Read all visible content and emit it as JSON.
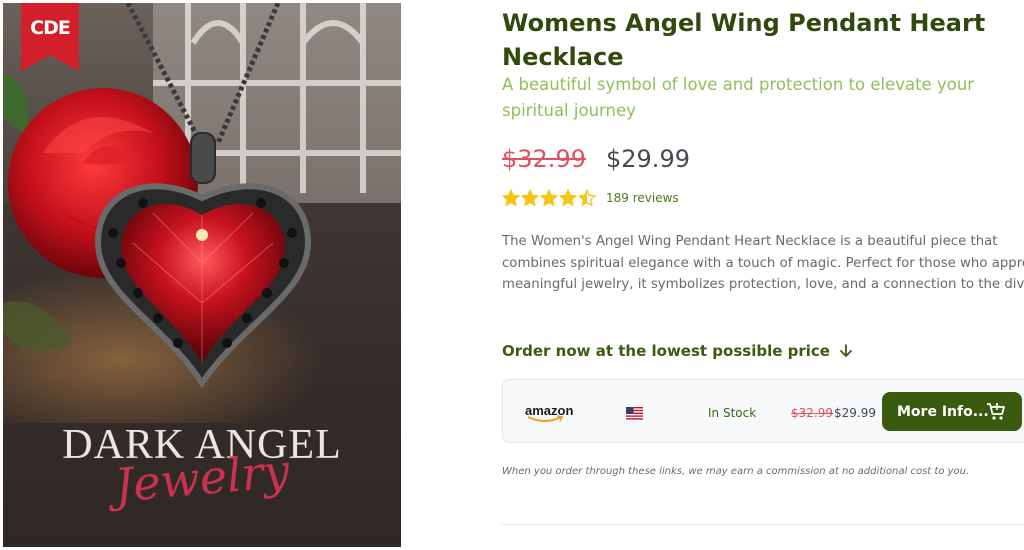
{
  "product": {
    "brand_logo_text": "CDE",
    "image_title": "DARK ANGEL",
    "image_subtitle": "Jewelry",
    "title": "Womens Angel Wing Pendant Heart Necklace",
    "subtitle": "A beautiful symbol of love and protection to elevate your spiritual journey",
    "price_old": "$32.99",
    "price_new": "$29.99",
    "rating": 4.5,
    "rating_max": 5,
    "reviews_text": "189 reviews",
    "description_lines": [
      "The Women's Angel Wing Pendant Heart Necklace is a beautiful piece that",
      "combines spiritual elegance with a touch of magic. Perfect for those who apprecia",
      "meaningful jewelry, it symbolizes protection, love, and a connection to the divine."
    ]
  },
  "order": {
    "heading": "Order now at the lowest possible price",
    "heading_icon": "arrow-down-icon",
    "offers": [
      {
        "retailer": "amazon",
        "country_flag": "us-flag-icon",
        "stock": "In Stock",
        "price_old": "$32.99",
        "price_new": "$29.99",
        "button_label": "More Info...",
        "button_icon": "cart-icon"
      }
    ],
    "disclaimer": "When you order through these links, we may earn a commission at no additional cost to you."
  },
  "colors": {
    "title": "#2f4a0c",
    "subtitle": "#8fbf5a",
    "price_old": "#e05060",
    "star": "#f5c518",
    "button_bg": "#3a5a0f",
    "brand_ribbon": "#d21f2a"
  }
}
